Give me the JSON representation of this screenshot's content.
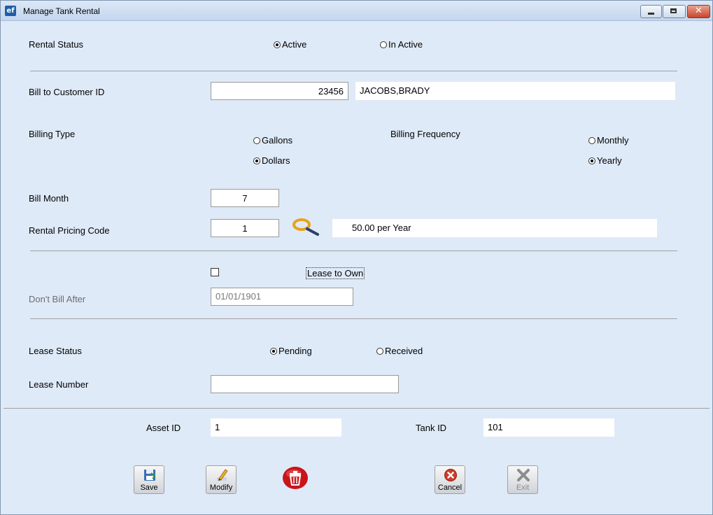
{
  "window": {
    "title": "Manage Tank Rental",
    "app_icon_text": "ef"
  },
  "rental_status": {
    "label": "Rental Status",
    "options": [
      {
        "label": "Active",
        "selected": true
      },
      {
        "label": "In Active",
        "selected": false
      }
    ]
  },
  "customer": {
    "label": "Bill to Customer ID",
    "id_value": "23456",
    "name_value": "JACOBS,BRADY"
  },
  "billing_type": {
    "label": "Billing Type",
    "options": [
      {
        "label": "Gallons",
        "selected": false
      },
      {
        "label": "Dollars",
        "selected": true
      }
    ]
  },
  "billing_frequency": {
    "label": "Billing Frequency",
    "options": [
      {
        "label": "Monthly",
        "selected": false
      },
      {
        "label": "Yearly",
        "selected": true
      }
    ]
  },
  "bill_month": {
    "label": "Bill Month",
    "value": "7"
  },
  "rental_pricing": {
    "label": "Rental Pricing Code",
    "code_value": "1",
    "description": "50.00 per Year",
    "lookup_icon": "magnifier-icon"
  },
  "lease_to_own": {
    "label": "Lease to Own",
    "checked": false
  },
  "dont_bill_after": {
    "label": "Don't Bill After",
    "value": "01/01/1901"
  },
  "lease_status": {
    "label": "Lease Status",
    "options": [
      {
        "label": "Pending",
        "selected": true
      },
      {
        "label": "Received",
        "selected": false
      }
    ]
  },
  "lease_number": {
    "label": "Lease Number",
    "value": ""
  },
  "asset": {
    "label": "Asset ID",
    "value": "1"
  },
  "tank": {
    "label": "Tank ID",
    "value": "101"
  },
  "buttons": {
    "save": "Save",
    "modify": "Modify",
    "cancel": "Cancel",
    "exit": "Exit"
  },
  "colors": {
    "background": "#dfeaf8",
    "accent": "#1f5fa8",
    "delete": "#c8141b",
    "cancel": "#d23b2a"
  }
}
